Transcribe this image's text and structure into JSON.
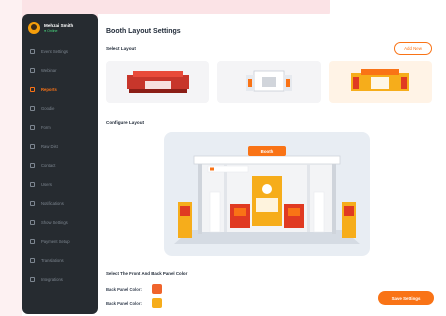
{
  "sidebar": {
    "user_name": "Mehzai Smith",
    "user_status": "● Online",
    "items": [
      {
        "label": "Event Settings",
        "icon": "calendar-icon",
        "active": false
      },
      {
        "label": "Webinar",
        "icon": "monitor-icon",
        "active": false
      },
      {
        "label": "Reports",
        "icon": "chart-icon",
        "active": true
      },
      {
        "label": "Goodie",
        "icon": "gift-icon",
        "active": false
      },
      {
        "label": "Form",
        "icon": "form-icon",
        "active": false
      },
      {
        "label": "Raw Dist",
        "icon": "list-icon",
        "active": false
      },
      {
        "label": "Contact",
        "icon": "contact-icon",
        "active": false
      },
      {
        "label": "Users",
        "icon": "users-icon",
        "active": false
      },
      {
        "label": "Notifications",
        "icon": "bell-icon",
        "active": false
      },
      {
        "label": "Show Settings",
        "icon": "gear-icon",
        "active": false
      },
      {
        "label": "Payment Setup",
        "icon": "card-icon",
        "active": false
      },
      {
        "label": "Translations",
        "icon": "translate-icon",
        "active": false
      },
      {
        "label": "Integrations",
        "icon": "plug-icon",
        "active": false
      }
    ]
  },
  "main": {
    "title": "Booth Layout Settings",
    "select_layout_label": "Select Layout",
    "add_new_label": "Add New",
    "configure_label": "Configure Layout",
    "booth_banner": "Booth",
    "front_back_label": "Select The Front And Back Panel Color",
    "back_panel_color_label": "Back Panel Color:",
    "back_panel_color_2_label": "Back Panel Color:",
    "back_panel_color": "#f0642c",
    "back_panel_color_2": "#f6ad1b",
    "save_label": "Save Settings"
  },
  "colors": {
    "accent": "#f97316",
    "sidebar_bg": "#262b30"
  }
}
